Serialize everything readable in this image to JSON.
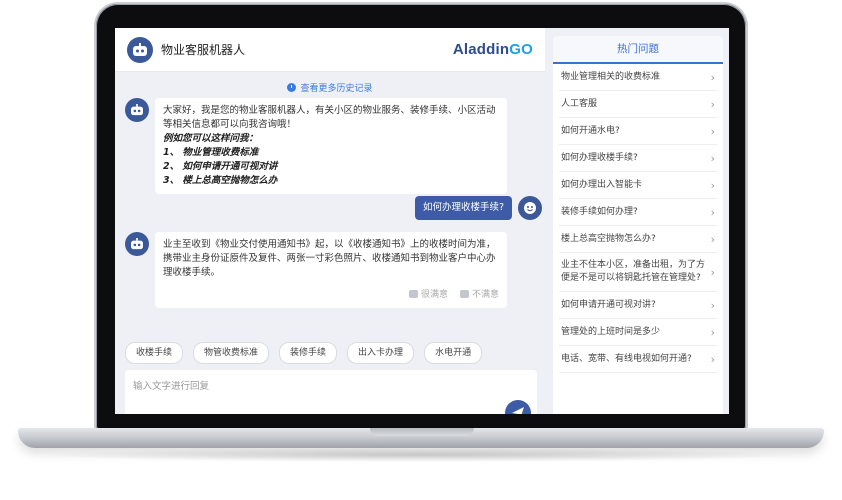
{
  "header": {
    "title": "物业客服机器人",
    "brand_main": "Aladdin",
    "brand_accent": "GO"
  },
  "history_link": "查看更多历史记录",
  "messages": {
    "bot_intro": {
      "greeting": "大家好，我是您的物业客服机器人，有关小区的物业服务、装修手续、小区活动等相关信息都可以向我咨询哦！",
      "example_heading": "例如您可以这样问我：",
      "examples": [
        "1、 物业管理收费标准",
        "2、 如何申请开通可视对讲",
        "3、 楼上总高空抛物怎么办"
      ]
    },
    "user_question": "如何办理收楼手续?",
    "bot_answer": "业主至收到《物业交付使用通知书》起，以《收楼通知书》上的收楼时间为准，携带业主身份证原件及复件、两张一寸彩色照片、收楼通知书到物业客户中心办理收楼手续。",
    "feedback": {
      "satisfied": "很满意",
      "unsatisfied": "不满意"
    }
  },
  "quick_replies": [
    "收楼手续",
    "物管收费标准",
    "装修手续",
    "出入卡办理",
    "水电开通"
  ],
  "input": {
    "placeholder": "输入文字进行回复"
  },
  "faq": {
    "title": "热门问题",
    "items": [
      "物业管理相关的收费标准",
      "人工客服",
      "如何开通水电?",
      "如何办理收楼手续?",
      "如何办理出入智能卡",
      "装修手续如何办理?",
      "楼上总高空抛物怎么办?",
      "业主不住本小区，准备出租，为了方便是不是可以将钥匙托管在管理处?",
      "如何申请开通可视对讲?",
      "管理处的上班时间是多少",
      "电话、宽带、有线电视如何开通?"
    ]
  },
  "colors": {
    "accent": "#3d5ba7",
    "link": "#3a7be0",
    "brand_accent": "#1aa1e6"
  }
}
